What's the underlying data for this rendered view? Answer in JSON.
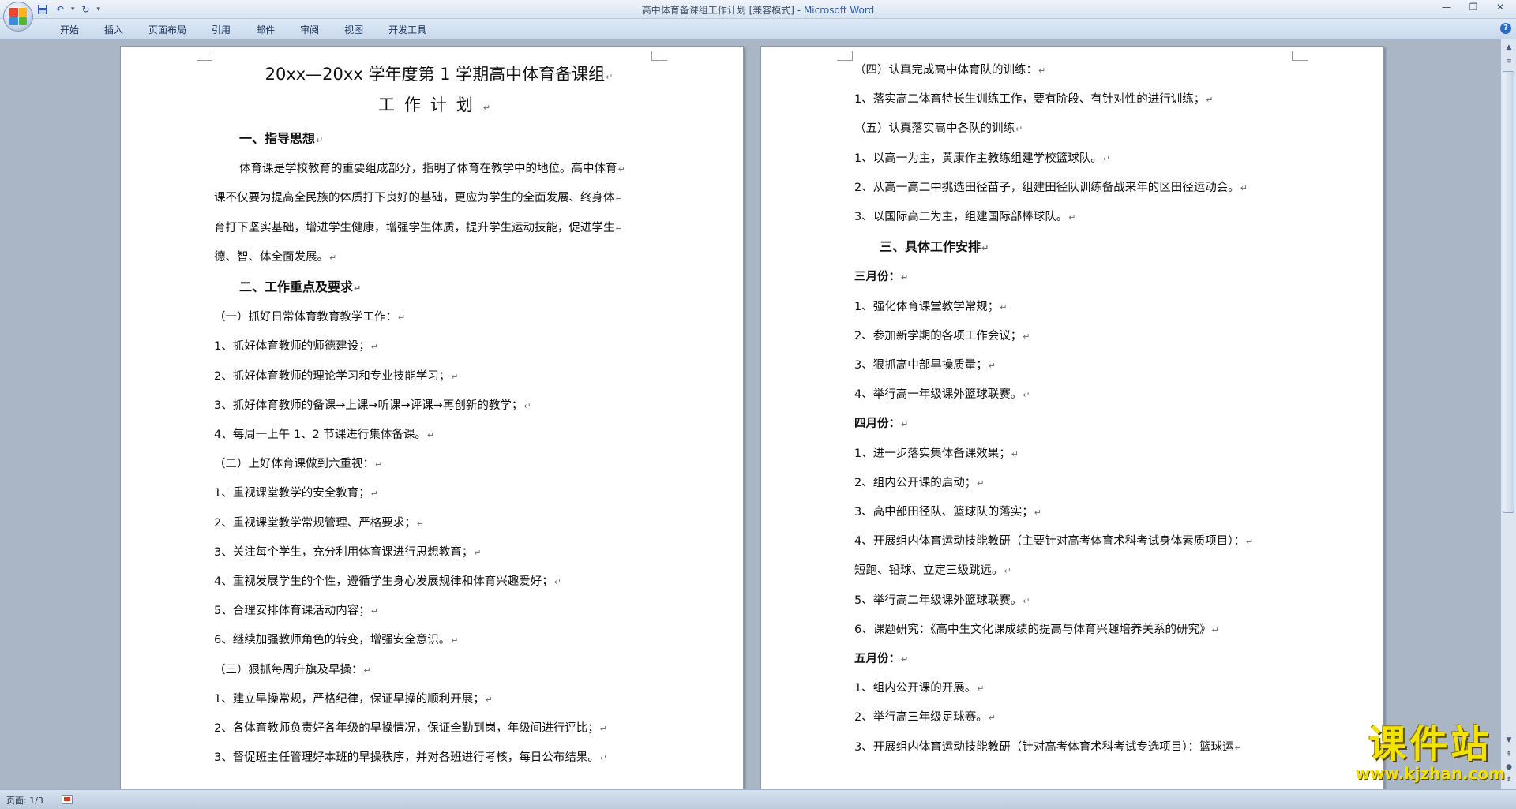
{
  "titlebar": {
    "doc_title": "高中体育备课组工作计划 [兼容模式]",
    "separator": " - ",
    "app_name": "Microsoft Word",
    "qat_dropdown": "▾"
  },
  "ribbon": {
    "tabs": [
      "开始",
      "插入",
      "页面布局",
      "引用",
      "邮件",
      "审阅",
      "视图",
      "开发工具"
    ],
    "help": "?"
  },
  "page1": {
    "title": "20xx—20xx 学年度第 1 学期高中体育备课组",
    "subtitle": "工作计划",
    "lines": [
      "一、指导思想",
      "体育课是学校教育的重要组成部分，指明了体育在教学中的地位。高中体育",
      "课不仅要为提高全民族的体质打下良好的基础，更应为学生的全面发展、终身体",
      "育打下坚实基础，增进学生健康，增强学生体质，提升学生运动技能，促进学生",
      "德、智、体全面发展。",
      "二、工作重点及要求",
      "（一）抓好日常体育教育教学工作：",
      "1、抓好体育教师的师德建设；",
      "2、抓好体育教师的理论学习和专业技能学习；",
      "3、抓好体育教师的备课→上课→听课→评课→再创新的教学；",
      "4、每周一上午 1、2 节课进行集体备课。",
      "（二）上好体育课做到六重视：",
      "1、重视课堂教学的安全教育；",
      "2、重视课堂教学常规管理、严格要求；",
      "3、关注每个学生，充分利用体育课进行思想教育；",
      "4、重视发展学生的个性，遵循学生身心发展规律和体育兴趣爱好；",
      "5、合理安排体育课活动内容；",
      "6、继续加强教师角色的转变，增强安全意识。",
      "（三）狠抓每周升旗及早操：",
      "1、建立早操常规，严格纪律，保证早操的顺利开展；",
      "2、各体育教师负责好各年级的早操情况，保证全勤到岗，年级间进行评比；",
      "3、督促班主任管理好本班的早操秩序，并对各班进行考核，每日公布结果。"
    ]
  },
  "page2": {
    "lines": [
      "（四）认真完成高中体育队的训练：",
      "1、落实高二体育特长生训练工作，要有阶段、有针对性的进行训练；",
      "（五）认真落实高中各队的训练",
      "1、以高一为主，黄康作主教练组建学校篮球队。",
      "2、从高一高二中挑选田径苗子，组建田径队训练备战来年的区田径运动会。",
      "3、以国际高二为主，组建国际部棒球队。",
      "三、具体工作安排",
      "三月份：",
      "1、强化体育课堂教学常规；",
      "2、参加新学期的各项工作会议；",
      "3、狠抓高中部早操质量；",
      "4、举行高一年级课外篮球联赛。",
      "四月份：",
      "1、进一步落实集体备课效果；",
      "2、组内公开课的启动；",
      "3、高中部田径队、篮球队的落实；",
      "4、开展组内体育运动技能教研（主要针对高考体育术科考试身体素质项目）：",
      "短跑、铅球、立定三级跳远。",
      "5、举行高二年级课外篮球联赛。",
      "6、课题研究：《高中生文化课成绩的提高与体育兴趣培养关系的研究》",
      "五月份：",
      "1、组内公开课的开展。",
      "2、举行高三年级足球赛。",
      "3、开展组内体育运动技能教研（针对高考体育术科考试专选项目）：篮球运"
    ]
  },
  "statusbar": {
    "page_info": "页面: 1/3"
  },
  "watermark": {
    "big": "课件站",
    "small": "www.kjzhan.com"
  },
  "colors": {
    "ribbon": "#c9d9ec",
    "workspace": "#aab6c6",
    "watermark": "#f2e200"
  }
}
